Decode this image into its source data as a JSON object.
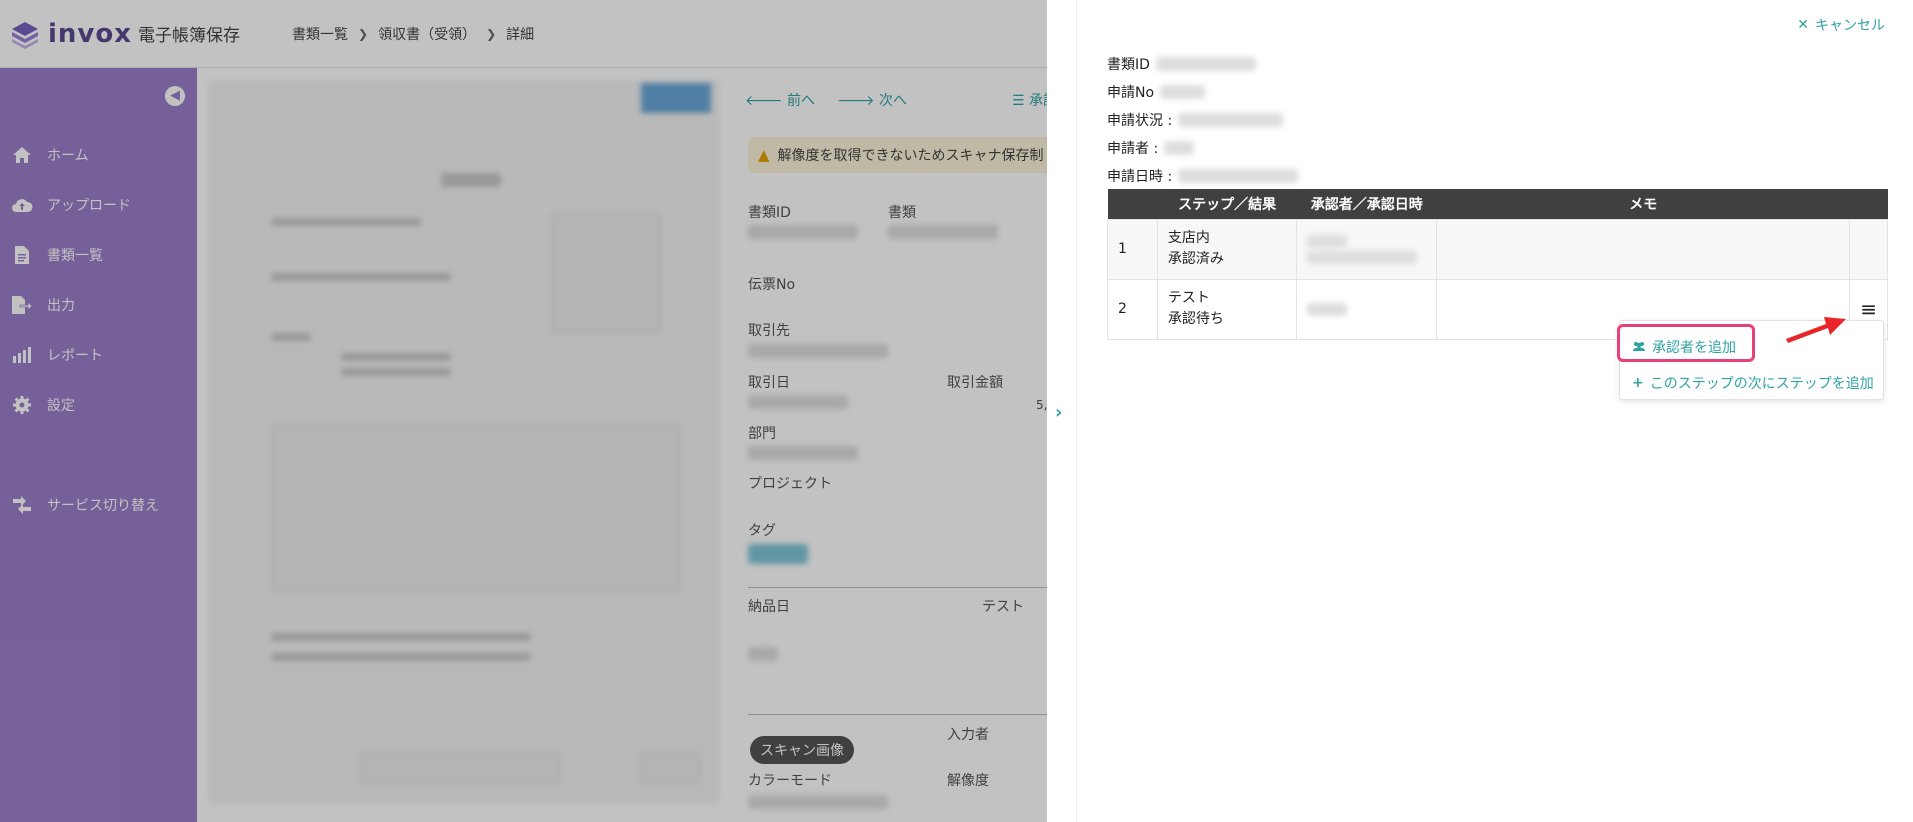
{
  "app": {
    "logo_word": "invox",
    "logo_sub": "電子帳簿保存",
    "breadcrumb": [
      "書類一覧",
      "領収書（受領）",
      "詳細"
    ]
  },
  "sidebar": {
    "items": [
      {
        "label": "ホーム",
        "icon": "home-icon"
      },
      {
        "label": "アップロード",
        "icon": "cloud-upload-icon"
      },
      {
        "label": "書類一覧",
        "icon": "document-icon"
      },
      {
        "label": "出力",
        "icon": "export-icon"
      },
      {
        "label": "レポート",
        "icon": "chart-icon"
      },
      {
        "label": "設定",
        "icon": "gear-icon"
      },
      {
        "label": "サービス切り替え",
        "icon": "switch-icon"
      }
    ]
  },
  "detail": {
    "prev": "前へ",
    "next": "次へ",
    "more": "承認",
    "warning": "解像度を取得できないためスキャナ保存制",
    "labels": {
      "doc_id": "書類ID",
      "doc": "書類",
      "slip_no": "伝票No",
      "partner": "取引先",
      "trade_date": "取引日",
      "amount": "取引金額",
      "amount_value": "5,",
      "dept": "部門",
      "project": "プロジェクト",
      "tag": "タグ",
      "delivery": "納品日",
      "test": "テスト",
      "scan_image": "スキャン画像",
      "input_by": "入力者",
      "color_mode": "カラーモード",
      "resolution": "解像度"
    }
  },
  "panel": {
    "cancel": "キャンセル",
    "info": [
      "書類ID",
      "申請No",
      "申請状況 :",
      "申請者 :",
      "申請日時 :"
    ],
    "table": {
      "headers": [
        "",
        "ステップ／結果",
        "承認者／承認日時",
        "メモ",
        ""
      ],
      "rows": [
        {
          "no": "1",
          "step": "支店内",
          "result": "承認済み"
        },
        {
          "no": "2",
          "step": "テスト",
          "result": "承認待ち"
        }
      ]
    },
    "menu": {
      "add_approver": "承認者を追加",
      "add_step": "このステップの次にステップを追加"
    }
  },
  "colors": {
    "accent": "#2fa3a3",
    "sidebar": "#9b7fc9",
    "highlight": "#e8407a",
    "arrow": "#e8262a"
  }
}
